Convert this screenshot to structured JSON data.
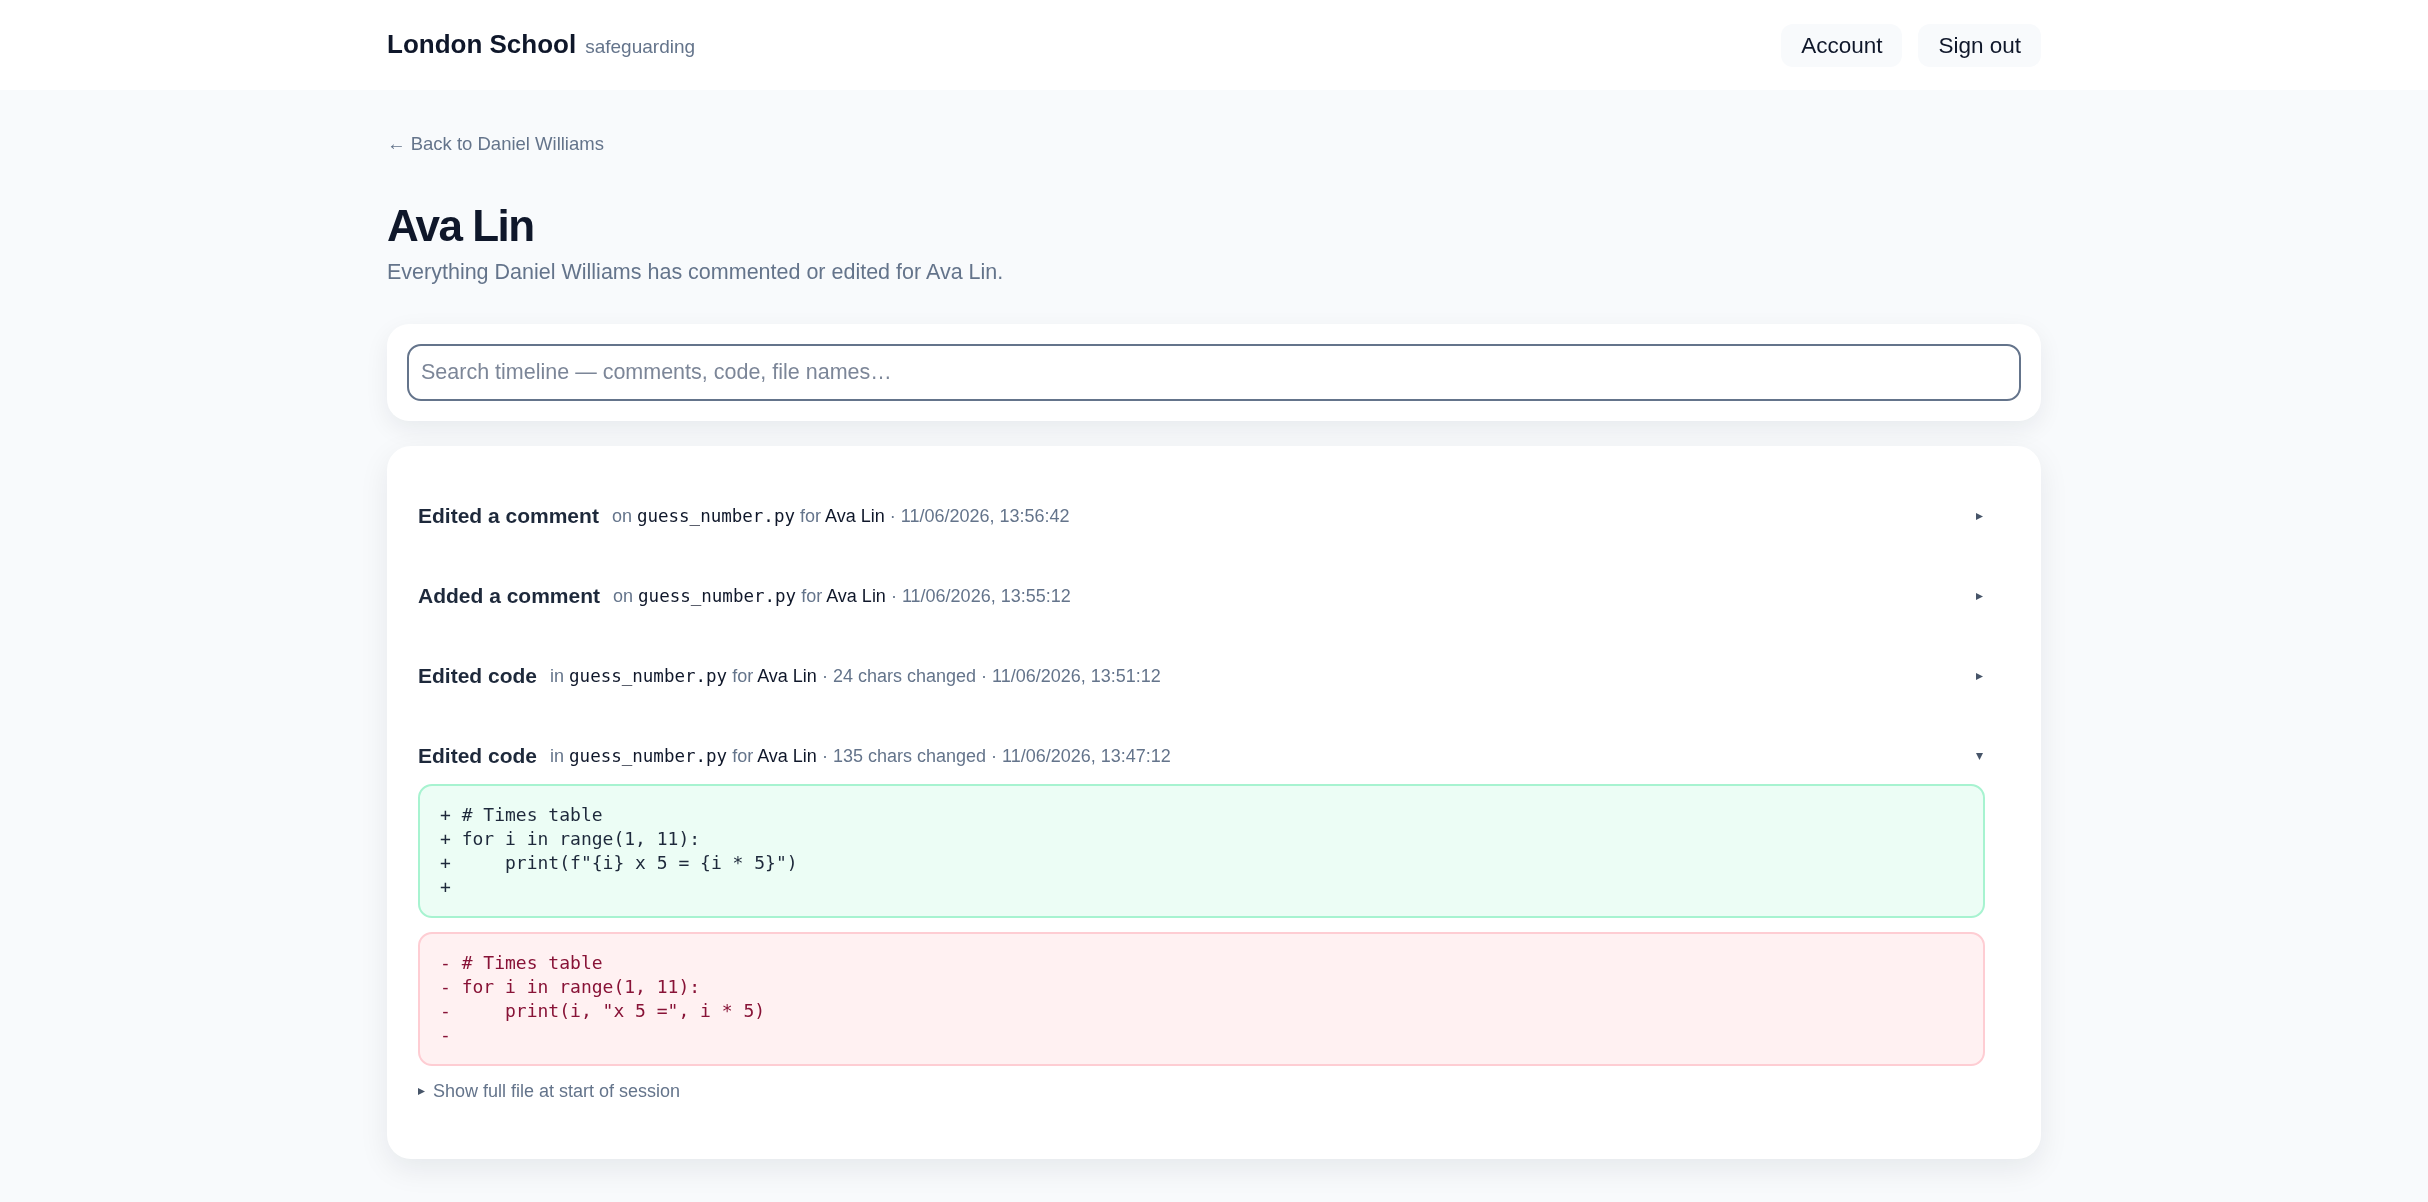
{
  "header": {
    "brand": "London School",
    "tagline": "safeguarding",
    "nav": [
      {
        "label": "Account"
      },
      {
        "label": "Sign out"
      }
    ]
  },
  "back_link": "← Back to Daniel Williams",
  "page": {
    "title": "Ava Lin",
    "subtitle": "Everything Daniel Williams has commented or edited for Ava Lin."
  },
  "search": {
    "placeholder": "Search timeline — comments, code, file names…"
  },
  "timeline": [
    {
      "action": "Edited a comment",
      "preposition": "on",
      "file": "guess_number.py",
      "for_label": "for",
      "student": "Ava Lin",
      "details": "· 11/06/2026, 13:56:42",
      "expanded": false
    },
    {
      "action": "Added a comment",
      "preposition": "on",
      "file": "guess_number.py",
      "for_label": "for",
      "student": "Ava Lin",
      "details": "· 11/06/2026, 13:55:12",
      "expanded": false
    },
    {
      "action": "Edited code",
      "preposition": "in",
      "file": "guess_number.py",
      "for_label": "for",
      "student": "Ava Lin",
      "details": "· 24 chars changed · 11/06/2026, 13:51:12",
      "expanded": false
    },
    {
      "action": "Edited code",
      "preposition": "in",
      "file": "guess_number.py",
      "for_label": "for",
      "student": "Ava Lin",
      "details": "· 135 chars changed · 11/06/2026, 13:47:12",
      "expanded": true,
      "diff": [
        {
          "kind": "added",
          "lines": [
            "+ # Times table",
            "+ for i in range(1, 11):",
            "+     print(f\"{i} x 5 = {i * 5}\")",
            "+"
          ]
        },
        {
          "kind": "removed",
          "lines": [
            "- # Times table",
            "- for i in range(1, 11):",
            "-     print(i, \"x 5 =\", i * 5)",
            "-"
          ]
        }
      ],
      "full_file": {
        "label": "Show full file at start of session",
        "expanded": false
      }
    }
  ]
}
